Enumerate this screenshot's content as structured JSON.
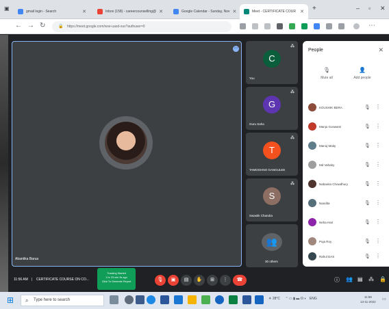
{
  "browser": {
    "tabs": [
      {
        "title": "gmail login - Search",
        "fav": "#4285f4"
      },
      {
        "title": "Inbox (158) - careercounselling@",
        "fav": "#ea4335"
      },
      {
        "title": "Google Calendar - Sunday, Nov",
        "fav": "#4285f4"
      },
      {
        "title": "Meet - CERTIFICATE COUR",
        "fav": "#00897b"
      }
    ],
    "new_tab": "+",
    "url": "https://meet.google.com/wxe-uasd-xuv?authuser=0"
  },
  "meet": {
    "main_participant": "Abantika Barua",
    "tiles": [
      {
        "initial": "C",
        "name": "You",
        "color": "#0b5e3b"
      },
      {
        "initial": "G",
        "name": "Guru Saha",
        "color": "#5e35b1"
      },
      {
        "initial": "T",
        "name": "TAMOGHNO GANGULEE",
        "color": "#f4511e"
      },
      {
        "initial": "S",
        "name": "Swastik Chandra",
        "color": "#8d6e63"
      },
      {
        "initial": "",
        "name": "30 others",
        "color": "#3c4043"
      }
    ],
    "meeting_time": "11:56 AM",
    "meeting_title": "CERTIFICATE COURSE ON CO...",
    "toast": {
      "line1": "Tracking Started",
      "line2": "1 hr 23 min 9s ago",
      "line3": "Click To Generate Report"
    }
  },
  "people": {
    "title": "People",
    "actions": [
      {
        "label": "Mute all",
        "icon": "mic-off-icon"
      },
      {
        "label": "Add people",
        "icon": "add-person-icon"
      }
    ],
    "participants": [
      {
        "name": "KOUSHIK BERA",
        "color": "#8d4b3a"
      },
      {
        "name": "Manju Goswami",
        "color": "#c0392b"
      },
      {
        "name": "Manoj Maity",
        "color": "#607d8b"
      },
      {
        "name": "Md Vahaby",
        "color": "#9e9e9e"
      },
      {
        "name": "Nabanita Chowdhury",
        "color": "#4e342e"
      },
      {
        "name": "Nandita",
        "color": "#546e7a"
      },
      {
        "name": "Neha Hari",
        "color": "#8e24aa"
      },
      {
        "name": "Puja Roy",
        "color": "#a1887f"
      },
      {
        "name": "Rahul DAS",
        "color": "#37474f"
      }
    ]
  },
  "taskbar": {
    "search_placeholder": "Type here to search",
    "weather": "28°C",
    "lang": "ENG",
    "time": "11:58",
    "date": "13-11-2022"
  }
}
